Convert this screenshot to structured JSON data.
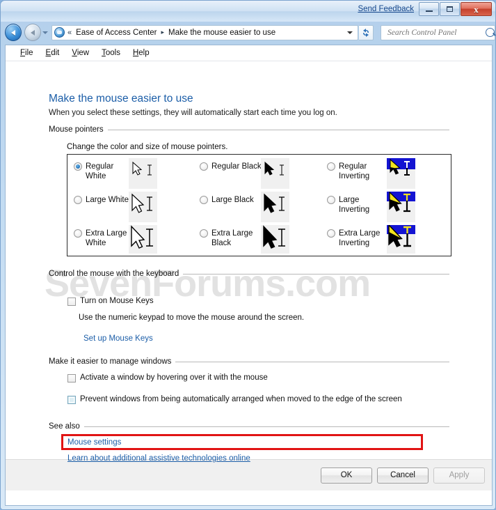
{
  "window": {
    "send_feedback": "Send Feedback",
    "minimize_tooltip": "Minimize",
    "maximize_tooltip": "Maximize",
    "close_glyph": "x"
  },
  "toolbar": {
    "back_tooltip": "Back",
    "forward_tooltip": "Forward",
    "breadcrumb_double_chevron": "«",
    "breadcrumbs": [
      {
        "label": "Ease of Access Center"
      },
      {
        "label": "Make the mouse easier to use"
      }
    ],
    "breadcrumb_separator": "▸",
    "refresh_glyph": "↻",
    "search_placeholder": "Search Control Panel",
    "search_value": ""
  },
  "menubar": {
    "items": [
      {
        "label": "File",
        "mnemonic": "F",
        "rest": "ile"
      },
      {
        "label": "Edit",
        "mnemonic": "E",
        "rest": "dit"
      },
      {
        "label": "View",
        "mnemonic": "V",
        "rest": "iew"
      },
      {
        "label": "Tools",
        "mnemonic": "T",
        "rest": "ools"
      },
      {
        "label": "Help",
        "mnemonic": "H",
        "rest": "elp"
      }
    ]
  },
  "page": {
    "watermark": "SevenForums.com",
    "title": "Make the mouse easier to use",
    "subtitle": "When you select these settings, they will automatically start each time you log on."
  },
  "mouse_pointers": {
    "group_label": "Mouse pointers",
    "caption": "Change the color and size of mouse pointers.",
    "options": [
      {
        "label": "Regular\nWhite",
        "selected": true,
        "style": "white",
        "size": "regular"
      },
      {
        "label": "Large White",
        "selected": false,
        "style": "white",
        "size": "large"
      },
      {
        "label": "Extra Large\nWhite",
        "selected": false,
        "style": "white",
        "size": "xlarge"
      },
      {
        "label": "Regular Black",
        "selected": false,
        "style": "black",
        "size": "regular"
      },
      {
        "label": "Large Black",
        "selected": false,
        "style": "black",
        "size": "large"
      },
      {
        "label": "Extra Large\nBlack",
        "selected": false,
        "style": "black",
        "size": "xlarge"
      },
      {
        "label": "Regular\nInverting",
        "selected": false,
        "style": "inverting",
        "size": "regular"
      },
      {
        "label": "Large\nInverting",
        "selected": false,
        "style": "inverting",
        "size": "large"
      },
      {
        "label": "Extra Large\nInverting",
        "selected": false,
        "style": "inverting",
        "size": "xlarge"
      }
    ]
  },
  "keyboard_control": {
    "group_label": "Control the mouse with the keyboard",
    "mouse_keys_checkbox": {
      "label": "Turn on Mouse Keys",
      "checked": false
    },
    "description": "Use the numeric keypad to move the mouse around the screen.",
    "setup_link": "Set up Mouse Keys"
  },
  "manage_windows": {
    "group_label": "Make it easier to manage windows",
    "activate_checkbox": {
      "label": "Activate a window by hovering over it with the mouse",
      "checked": false
    },
    "prevent_checkbox": {
      "label": "Prevent windows from being automatically arranged when moved to the edge of the screen",
      "checked": false,
      "focused": true,
      "highlighted": true
    }
  },
  "see_also": {
    "group_label": "See also",
    "links": [
      {
        "label": "Mouse settings",
        "underline": false
      },
      {
        "label": "Learn about additional assistive technologies online",
        "underline": true
      }
    ]
  },
  "buttons": {
    "ok": "OK",
    "cancel": "Cancel",
    "apply": "Apply",
    "apply_disabled": true
  },
  "colors": {
    "accent_blue": "#1c5ea8",
    "highlight_red": "#e11414",
    "inverting_blue": "#1414d2",
    "inverting_yellow": "#f2e21e",
    "title_text": "#1c5ea8"
  }
}
